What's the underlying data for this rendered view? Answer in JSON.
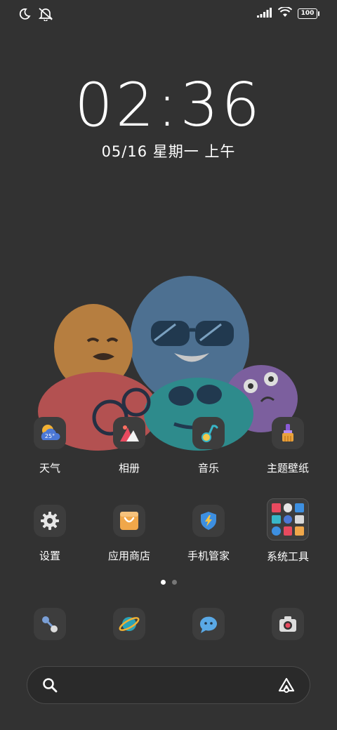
{
  "status_bar": {
    "battery": "100"
  },
  "lockscreen": {
    "time": "02:36",
    "date": "05/16 星期一 上午"
  },
  "apps_row1": [
    {
      "label": "天气",
      "temp": "25°"
    },
    {
      "label": "相册"
    },
    {
      "label": "音乐"
    },
    {
      "label": "主题壁纸"
    }
  ],
  "apps_row2": [
    {
      "label": "设置"
    },
    {
      "label": "应用商店"
    },
    {
      "label": "手机管家"
    },
    {
      "label": "系统工具"
    }
  ],
  "page_indicator": {
    "pages": 2,
    "current": 1
  },
  "colors": {
    "background": "#323232",
    "icon_bg": "#3d3d3d"
  }
}
